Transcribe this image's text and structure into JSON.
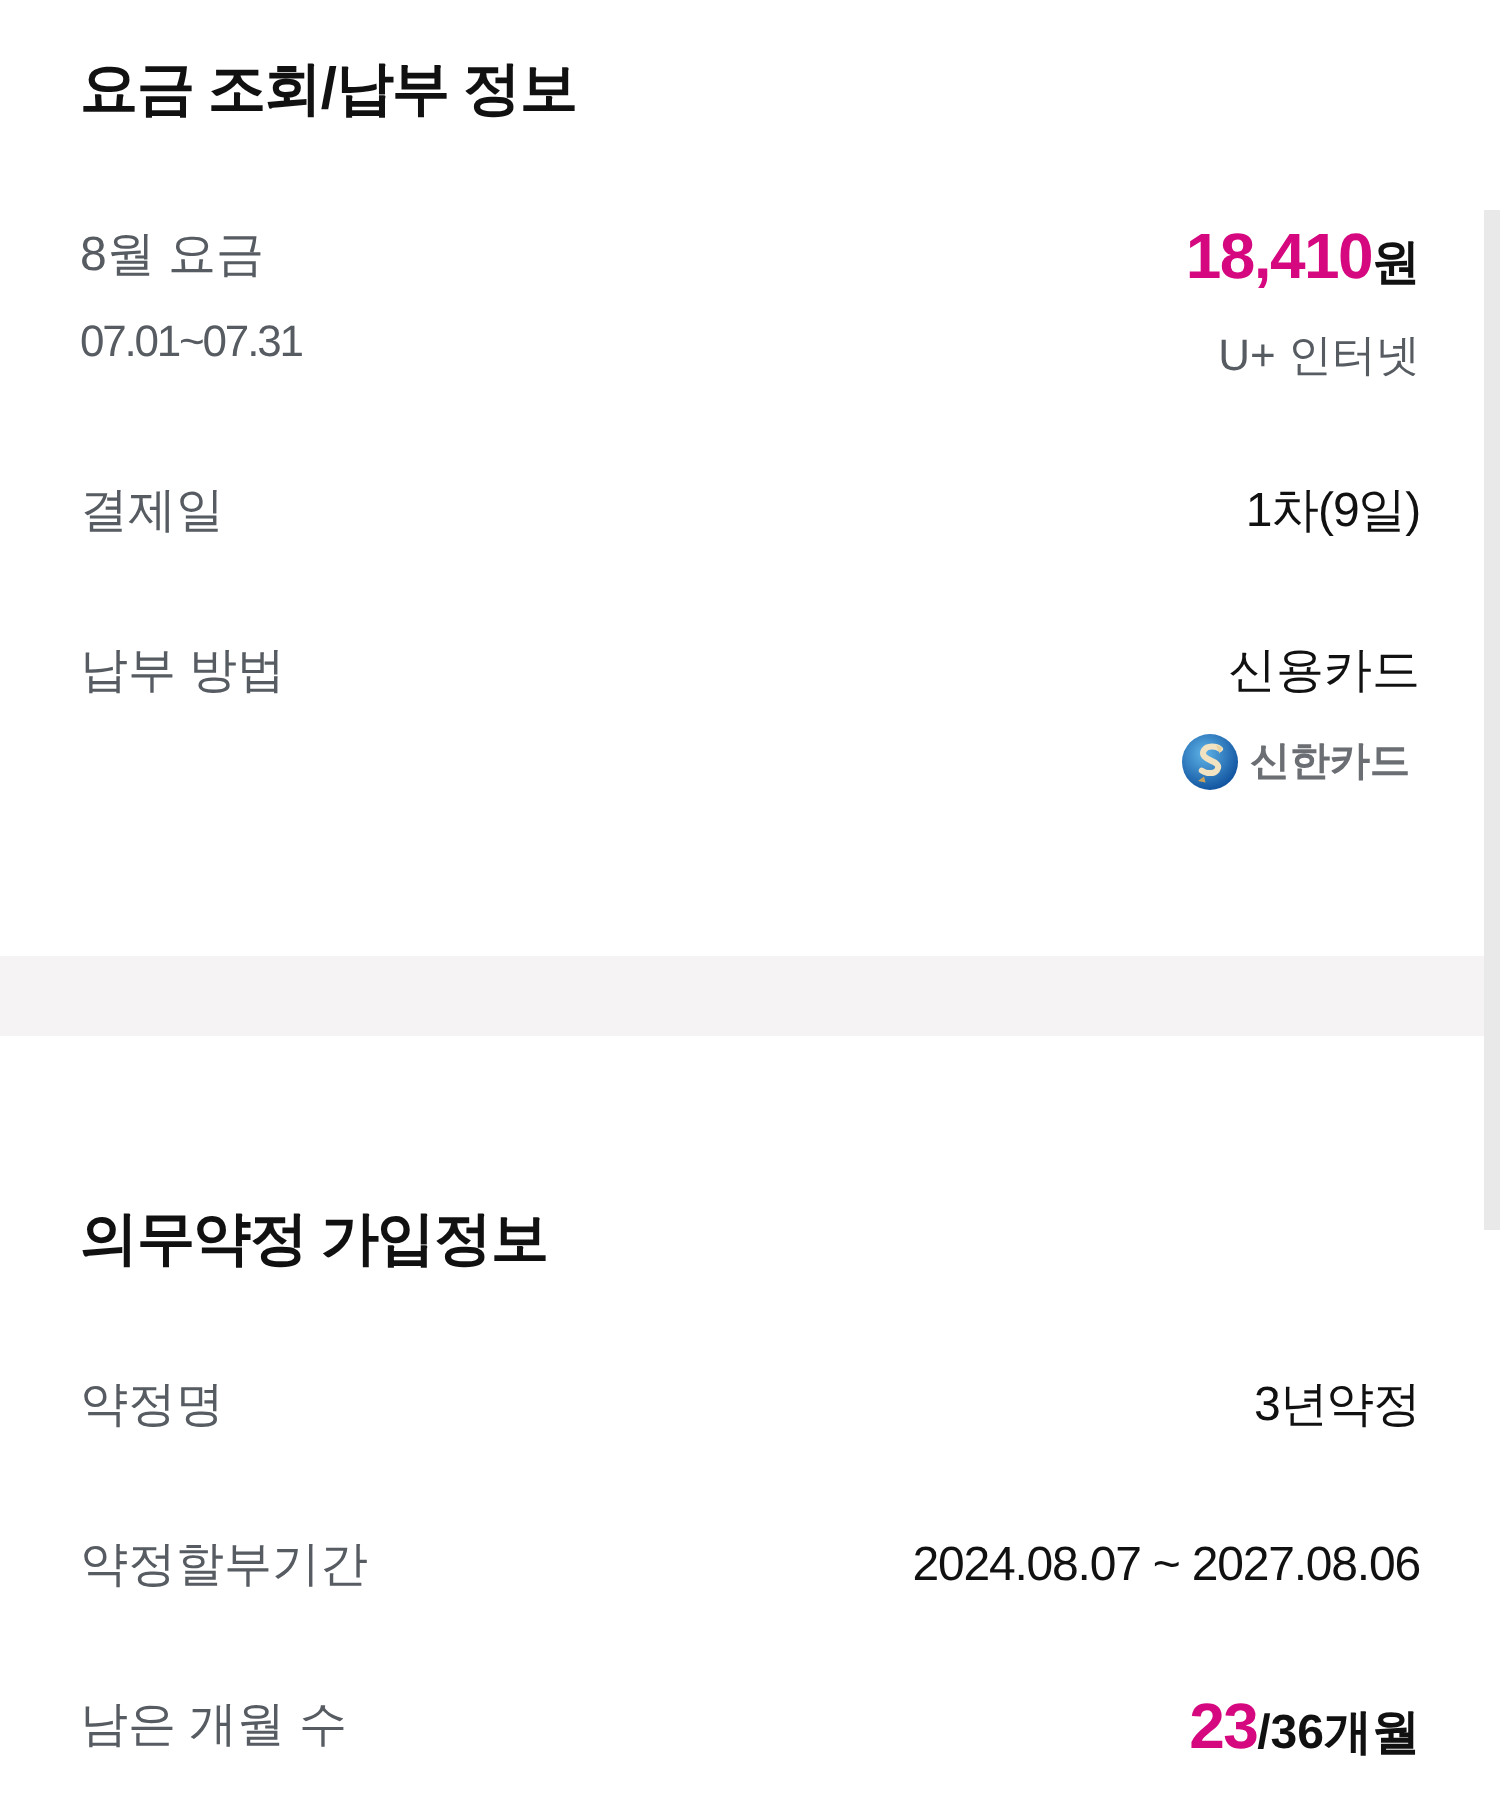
{
  "sections": [
    {
      "title": "요금 조회/납부 정보",
      "rows": [
        {
          "kind": "bill",
          "label": "8월 요금",
          "period": "07.01~07.31",
          "amount": "18,410",
          "unit": "원",
          "service": "U+ 인터넷"
        },
        {
          "kind": "text",
          "label": "결제일",
          "value": "1차(9일)"
        },
        {
          "kind": "payment",
          "label": "납부 방법",
          "value": "신용카드",
          "card": "신한카드"
        }
      ]
    },
    {
      "title": "의무약정 가입정보",
      "rows": [
        {
          "kind": "text",
          "label": "약정명",
          "value": "3년약정"
        },
        {
          "kind": "text",
          "label": "약정할부기간",
          "value": "2024.08.07 ~ 2027.08.06"
        },
        {
          "kind": "count",
          "label": "남은 개월 수",
          "remaining": "23",
          "total": "/36개월"
        }
      ]
    }
  ]
}
